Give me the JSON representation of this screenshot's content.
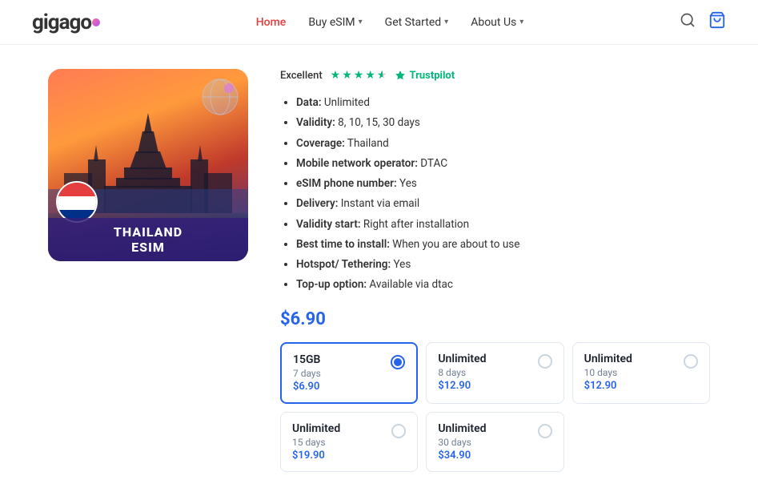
{
  "header": {
    "logo_text": "gigago",
    "nav_items": [
      {
        "label": "Home",
        "active": false,
        "has_dropdown": false
      },
      {
        "label": "Buy eSIM",
        "active": false,
        "has_dropdown": true
      },
      {
        "label": "Get Started",
        "active": false,
        "has_dropdown": true
      },
      {
        "label": "About Us",
        "active": false,
        "has_dropdown": true
      }
    ]
  },
  "product": {
    "image_label_line1": "THAILAND",
    "image_label_line2": "ESIM",
    "rating_label": "Excellent",
    "rating_stars": 4.5,
    "trustpilot_label": "Trustpilot",
    "specs": [
      {
        "key": "Data",
        "value": "Unlimited"
      },
      {
        "key": "Validity",
        "value": "8, 10, 15, 30 days"
      },
      {
        "key": "Coverage",
        "value": "Thailand"
      },
      {
        "key": "Mobile network operator",
        "value": "DTAC"
      },
      {
        "key": "eSIM phone number",
        "value": "Yes"
      },
      {
        "key": "Delivery",
        "value": "Instant via email"
      },
      {
        "key": "Validity start",
        "value": "Right after installation"
      },
      {
        "key": "Best time to install",
        "value": "When you are about to use"
      },
      {
        "key": "Hotspot/ Tethering",
        "value": "Yes"
      },
      {
        "key": "Top-up option",
        "value": "Available via dtac"
      }
    ],
    "price": "$6.90",
    "plans": [
      {
        "name": "15GB",
        "validity": "7 days",
        "price": "$6.90",
        "selected": true
      },
      {
        "name": "Unlimited",
        "validity": "8 days",
        "price": "$12.90",
        "selected": false
      },
      {
        "name": "Unlimited",
        "validity": "10 days",
        "price": "$12.90",
        "selected": false
      },
      {
        "name": "Unlimited",
        "validity": "15 days",
        "price": "$19.90",
        "selected": false
      },
      {
        "name": "Unlimited",
        "validity": "30 days",
        "price": "$34.90",
        "selected": false
      }
    ]
  }
}
